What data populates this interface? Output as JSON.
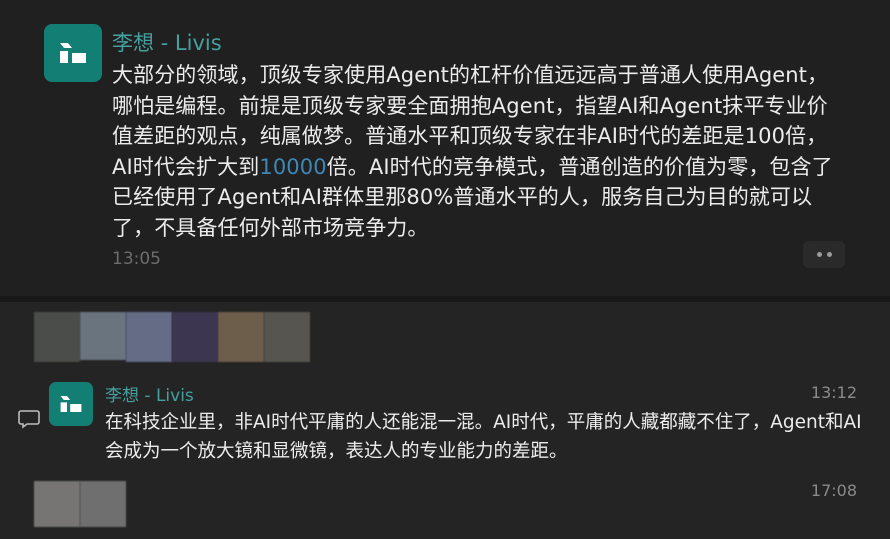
{
  "message1": {
    "sender": "李想 - Livis",
    "text_before": "大部分的领域，顶级专家使用Agent的杠杆价值远远高于普通人使用Agent，哪怕是编程。前提是顶级专家要全面拥抱Agent，指望AI和Agent抹平专业价值差距的观点，纯属做梦。普通水平和顶级专家在非AI时代的差距是100倍，AI时代会扩大到",
    "highlight_number": "10000",
    "text_after": "倍。AI时代的竞争模式，普通创造的价值为零，包含了已经使用了Agent和AI群体里那80%普通水平的人，服务自己为目的就可以了，不具备任何外部市场竞争力。",
    "time": "13:05",
    "highlight_color": "#3f87b5"
  },
  "message2": {
    "sender": "李想 - Livis",
    "time": "13:12",
    "text": "在科技企业里，非AI时代平庸的人还能混一混。AI时代，平庸的人藏都藏不住了，Agent和AI会成为一个放大镜和显微镜，表达人的专业能力的差距。"
  },
  "message3": {
    "time": "17:08"
  },
  "icons": {
    "avatar": "logo-icon",
    "more": "more-dots-icon",
    "comment": "comment-icon"
  },
  "colors": {
    "avatar_bg": "#137e73",
    "sender_name": "#46a0a0",
    "background": "#1b1b1b"
  }
}
